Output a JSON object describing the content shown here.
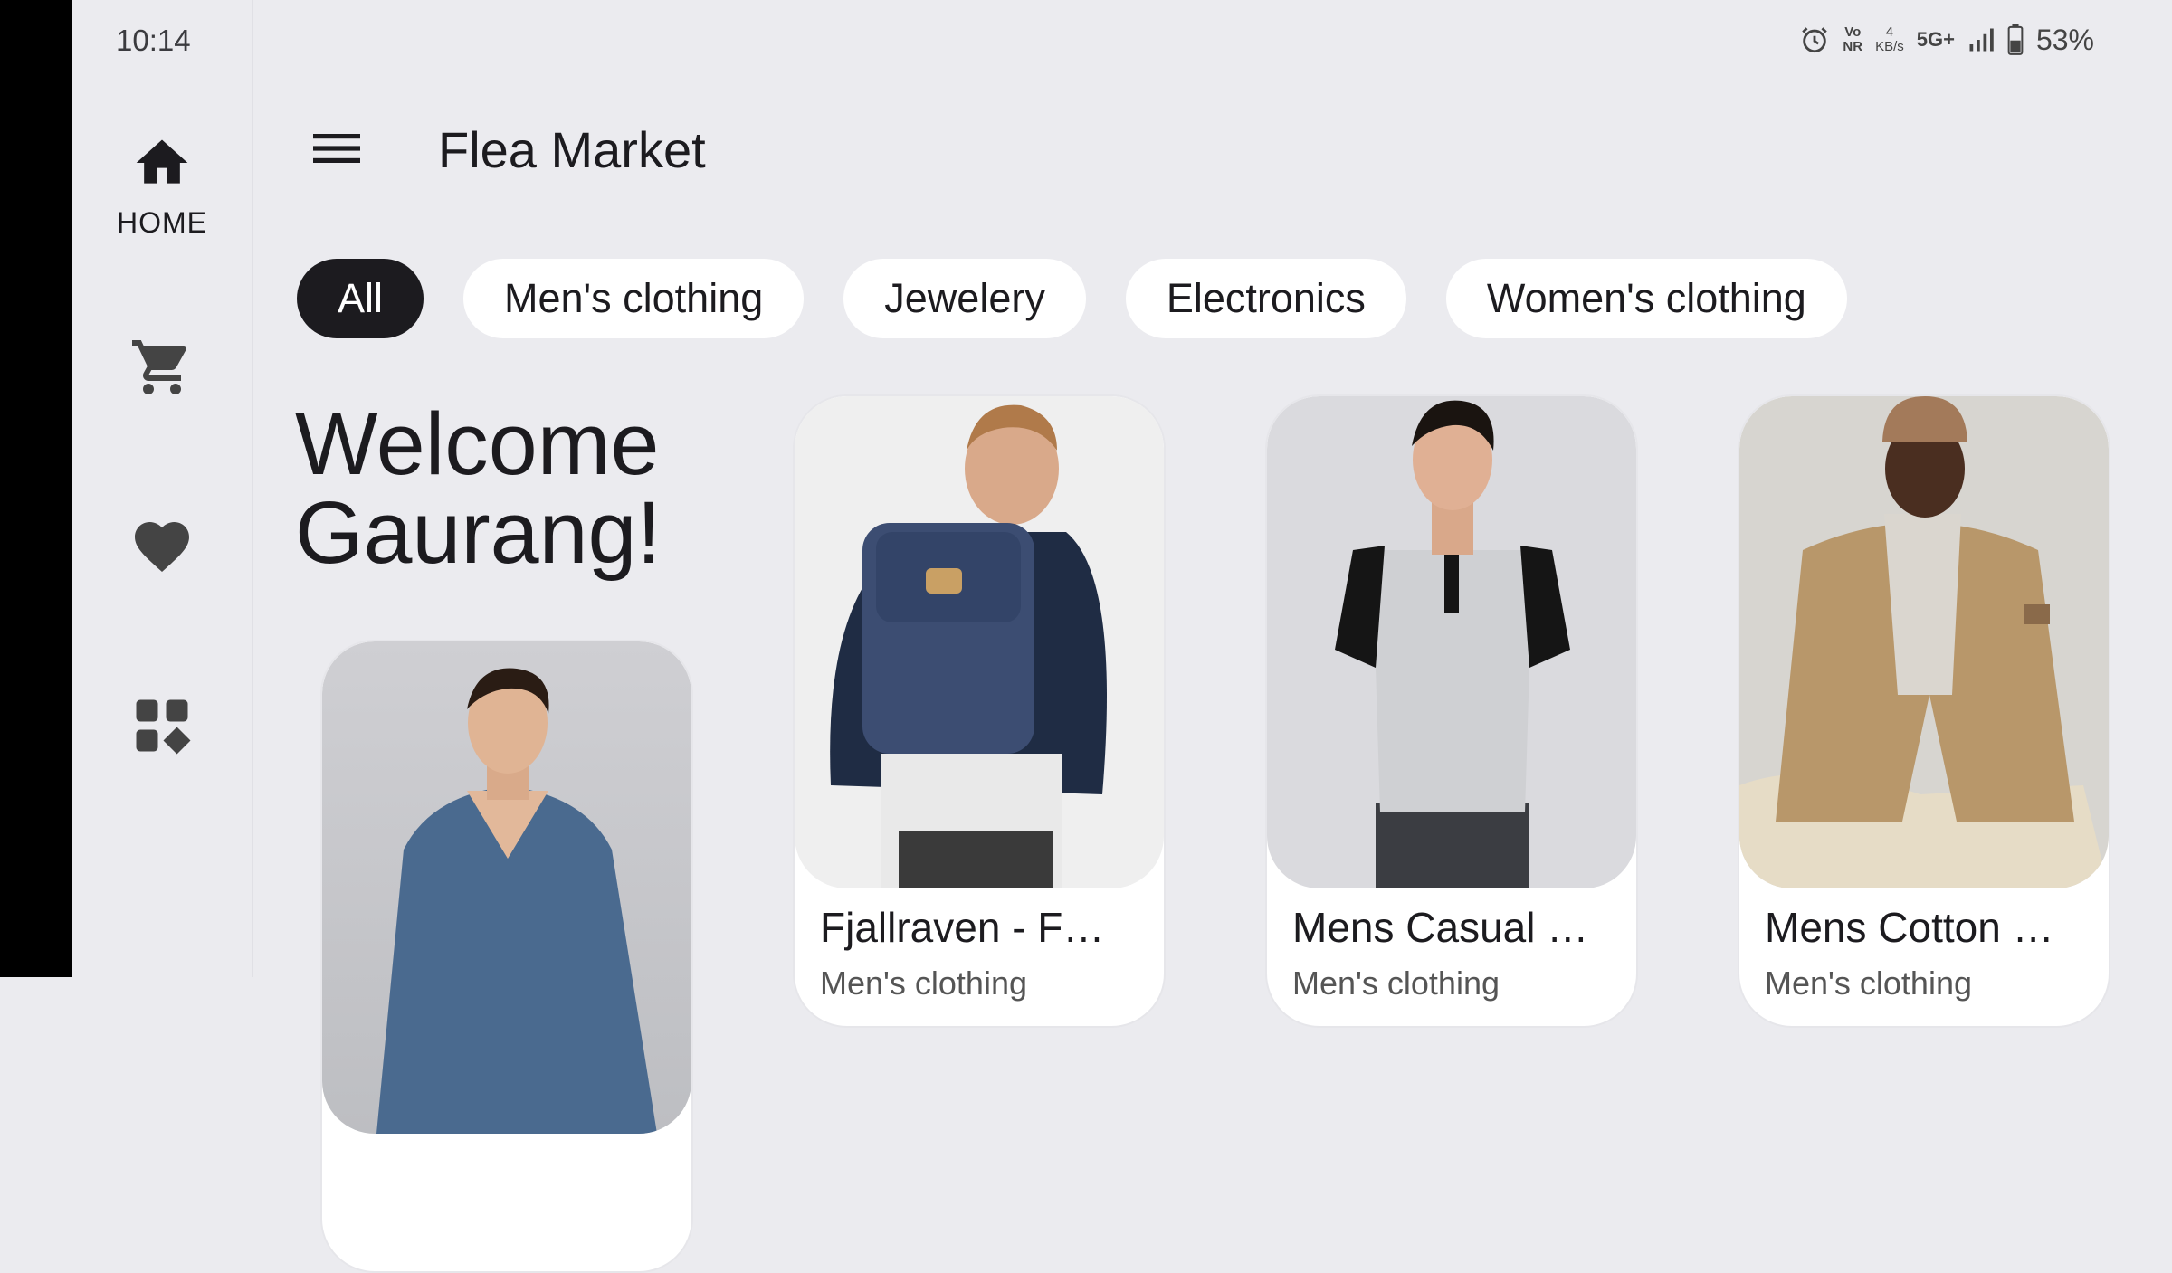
{
  "status_bar": {
    "time": "10:14",
    "vonr": "Vo\nNR",
    "speed_value": "4",
    "speed_unit": "KB/s",
    "network": "5G+",
    "battery": "53%"
  },
  "rail": {
    "items": [
      {
        "icon": "home-icon",
        "label": "HOME",
        "selected": true
      },
      {
        "icon": "cart-icon"
      },
      {
        "icon": "heart-icon"
      },
      {
        "icon": "categories-icon"
      }
    ]
  },
  "app_bar": {
    "title": "Flea Market"
  },
  "filters": {
    "chips": [
      {
        "label": "All",
        "selected": true
      },
      {
        "label": "Men's clothing"
      },
      {
        "label": "Jewelery"
      },
      {
        "label": "Electronics"
      },
      {
        "label": "Women's clothing"
      }
    ]
  },
  "greeting": {
    "line1": "Welcome",
    "line2": "Gaurang!"
  },
  "products": [
    {
      "name": "",
      "category": "",
      "image": "man in blue v-neck sweater"
    },
    {
      "name": "Fjallraven - F…",
      "category": "Men's clothing",
      "image": "man wearing navy backpack"
    },
    {
      "name": "Mens Casual …",
      "category": "Men's clothing",
      "image": "man in raglan henley t-shirt"
    },
    {
      "name": "Mens Cotton …",
      "category": "Men's clothing",
      "image": "man in khaki cotton jacket"
    }
  ],
  "colors": {
    "background": "#ebebef",
    "chip_selected": "#1c1b1f",
    "card": "#ffffff"
  }
}
